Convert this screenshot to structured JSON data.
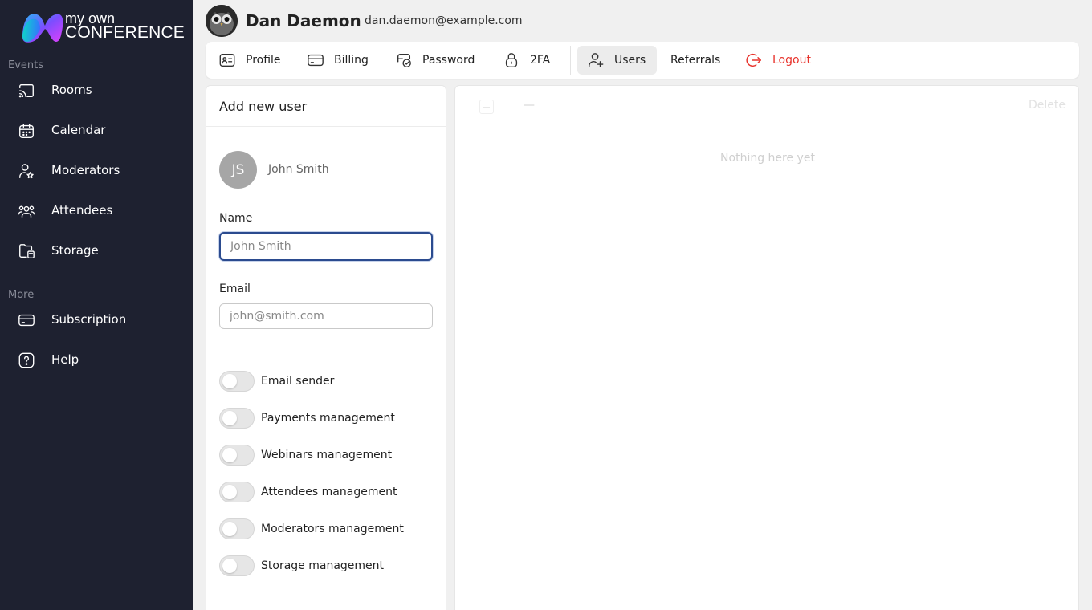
{
  "brand": {
    "line1": "my own",
    "line2": "CONFERENCE"
  },
  "sidebar": {
    "events_title": "Events",
    "events": [
      {
        "label": "Rooms",
        "icon": "cast-icon"
      },
      {
        "label": "Calendar",
        "icon": "calendar-icon"
      },
      {
        "label": "Moderators",
        "icon": "user-star-icon"
      },
      {
        "label": "Attendees",
        "icon": "users-icon"
      },
      {
        "label": "Storage",
        "icon": "folder-icon"
      }
    ],
    "more_title": "More",
    "more": [
      {
        "label": "Subscription",
        "icon": "card-icon"
      },
      {
        "label": "Help",
        "icon": "help-icon"
      }
    ]
  },
  "header": {
    "name": "Dan Daemon",
    "email": "dan.daemon@example.com"
  },
  "tabs": {
    "profile": "Profile",
    "billing": "Billing",
    "password": "Password",
    "twofa": "2FA",
    "users": "Users",
    "referrals": "Referrals",
    "logout": "Logout",
    "active": "Users"
  },
  "add_user": {
    "title": "Add new user",
    "avatar_initials": "JS",
    "preview_name": "John Smith",
    "name_label": "Name",
    "name_placeholder": "John Smith",
    "email_label": "Email",
    "email_placeholder": "john@smith.com",
    "permissions": [
      {
        "label": "Email sender",
        "enabled": false
      },
      {
        "label": "Payments management",
        "enabled": false
      },
      {
        "label": "Webinars management",
        "enabled": false
      },
      {
        "label": "Attendees management",
        "enabled": false
      },
      {
        "label": "Moderators management",
        "enabled": false
      },
      {
        "label": "Storage management",
        "enabled": false
      }
    ]
  },
  "users_list": {
    "count_placeholder": "—",
    "delete_label": "Delete",
    "empty_text": "Nothing here yet"
  },
  "colors": {
    "sidebar_bg": "#1e2130",
    "logout": "#e8332c",
    "focus_border": "#2b4b8f"
  }
}
